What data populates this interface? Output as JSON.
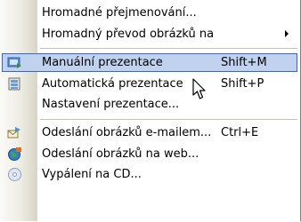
{
  "menu": {
    "items": [
      {
        "label": "Hromadné přejmenování...",
        "shortcut": ""
      },
      {
        "label": "Hromadný převod obrázků na",
        "shortcut": "",
        "submenu": true
      },
      {
        "label": "Manuální prezentace",
        "shortcut": "Shift+M",
        "icon": "slideshow-manual-icon",
        "highlighted": true
      },
      {
        "label": "Automatická prezentace",
        "shortcut": "Shift+P",
        "icon": "slideshow-auto-icon"
      },
      {
        "label": "Nastavení prezentace...",
        "shortcut": ""
      },
      {
        "label": "Odeslání obrázků e-mailem...",
        "shortcut": "Ctrl+E",
        "icon": "email-icon"
      },
      {
        "label": "Odeslání obrázků na web...",
        "shortcut": "",
        "icon": "globe-icon"
      },
      {
        "label": "Vypálení na CD...",
        "shortcut": "",
        "icon": "cd-icon"
      }
    ]
  },
  "colors": {
    "highlight_bg": "#c1d2ee",
    "highlight_border": "#316ac5"
  }
}
